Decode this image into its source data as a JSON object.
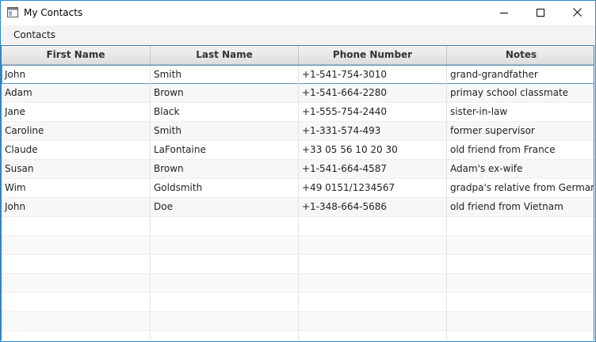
{
  "window": {
    "title": "My Contacts",
    "icons": {
      "app": "app-window-icon",
      "minimize": "minimize-icon",
      "maximize": "maximize-icon",
      "close": "close-icon"
    }
  },
  "menubar": {
    "items": [
      {
        "label": "Contacts"
      }
    ]
  },
  "table": {
    "columns": [
      "First Name",
      "Last Name",
      "Phone Number",
      "Notes"
    ],
    "rows": [
      [
        "John",
        "Smith",
        "+1-541-754-3010",
        "grand-grandfather"
      ],
      [
        "Adam",
        "Brown",
        "+1-541-664-2280",
        "primay school classmate"
      ],
      [
        "Jane",
        "Black",
        "+1-555-754-2440",
        "sister-in-law"
      ],
      [
        "Caroline",
        "Smith",
        "+1-331-574-493",
        "former supervisor"
      ],
      [
        "Claude",
        "LaFontaine",
        "+33 05 56 10 20 30",
        "old friend from France"
      ],
      [
        "Susan",
        "Brown",
        "+1-541-664-4587",
        "Adam's ex-wife"
      ],
      [
        "Wim",
        "Goldsmith",
        "+49 0151/1234567",
        "gradpa's relative from Germany"
      ],
      [
        "John",
        "Doe",
        "+1-348-664-5686",
        "old friend from Vietnam"
      ]
    ],
    "selected_row": 0,
    "colors": {
      "selection_border": "#5b95c5",
      "window_border": "#2b8bd0"
    }
  }
}
